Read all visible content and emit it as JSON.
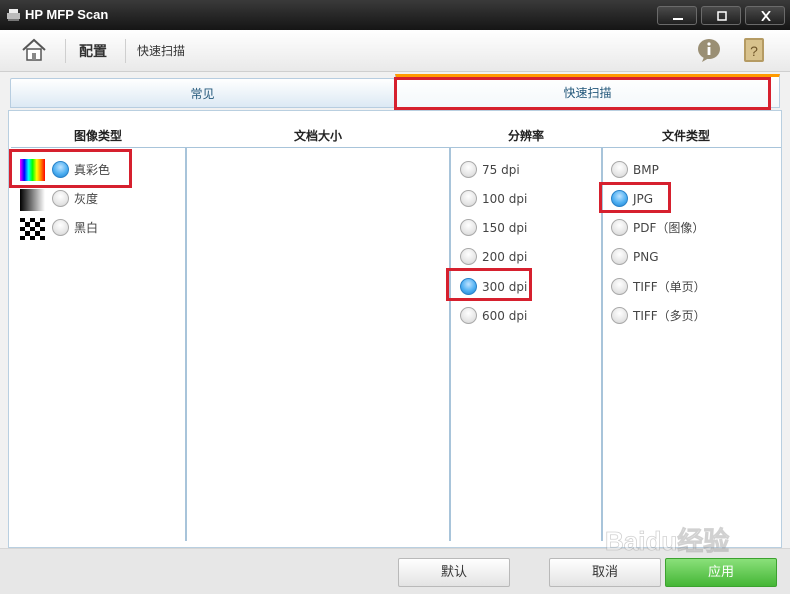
{
  "window": {
    "title": "HP MFP Scan"
  },
  "toolbar": {
    "config": "配置",
    "quick_scan": "快速扫描"
  },
  "tabs": [
    {
      "label": "常见"
    },
    {
      "label": "快速扫描"
    }
  ],
  "columns": {
    "image_type": {
      "title": "图像类型",
      "options": [
        "真彩色",
        "灰度",
        "黑白"
      ],
      "selected": "真彩色"
    },
    "doc_size": {
      "title": "文档大小"
    },
    "resolution": {
      "title": "分辨率",
      "options": [
        "75 dpi",
        "100 dpi",
        "150 dpi",
        "200 dpi",
        "300 dpi",
        "600 dpi"
      ],
      "selected": "300 dpi"
    },
    "file_type": {
      "title": "文件类型",
      "options": [
        "BMP",
        "JPG",
        "PDF（图像）",
        "PNG",
        "TIFF（单页）",
        "TIFF（多页）"
      ],
      "selected": "JPG"
    }
  },
  "buttons": {
    "default": "默认",
    "cancel": "取消",
    "apply": "应用"
  },
  "watermark": {
    "text": "Baidu经验"
  },
  "colors": {
    "highlight": "#d6202e",
    "tab_accent": "#ff9a00",
    "radio_checked": "#4fb0f2",
    "apply_green": "#45b636"
  }
}
